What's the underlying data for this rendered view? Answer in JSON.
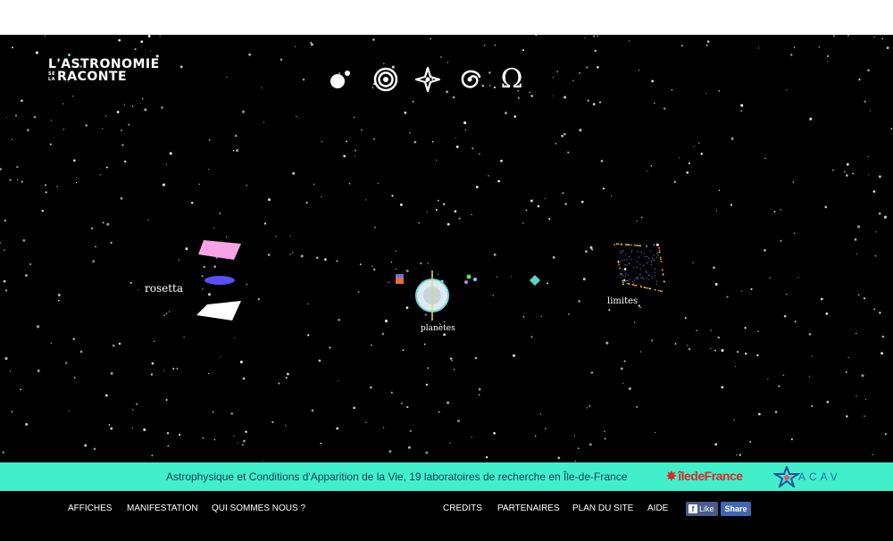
{
  "logo": {
    "line1": "L'ASTRONOMIE",
    "small1": "SE",
    "small2": "LA",
    "line2": "RACONTE"
  },
  "topnav": {
    "omega_glyph": "Ω"
  },
  "scene": {
    "rosetta_label": "rosetta",
    "planetes_label": "planètes",
    "limites_label": "limites"
  },
  "band": {
    "text": "Astrophysique et Conditions d'Apparition de la Vie, 19 laboratoires de recherche en Île-de-France",
    "idf_logo": "îledeFrance",
    "acav_logo": "ACAV"
  },
  "footer": {
    "affiches": "AFFICHES",
    "manifestation": "MANIFESTATION",
    "qui": "QUI SOMMES NOUS ?",
    "credits": "CREDITS",
    "partenaires": "PARTENAIRES",
    "plan": "PLAN DU SITE",
    "aide": "AIDE",
    "like": "Like",
    "share": "Share"
  },
  "colors": {
    "accent": "#41f0cb",
    "background": "#000000",
    "facebook": "#4267b2"
  }
}
